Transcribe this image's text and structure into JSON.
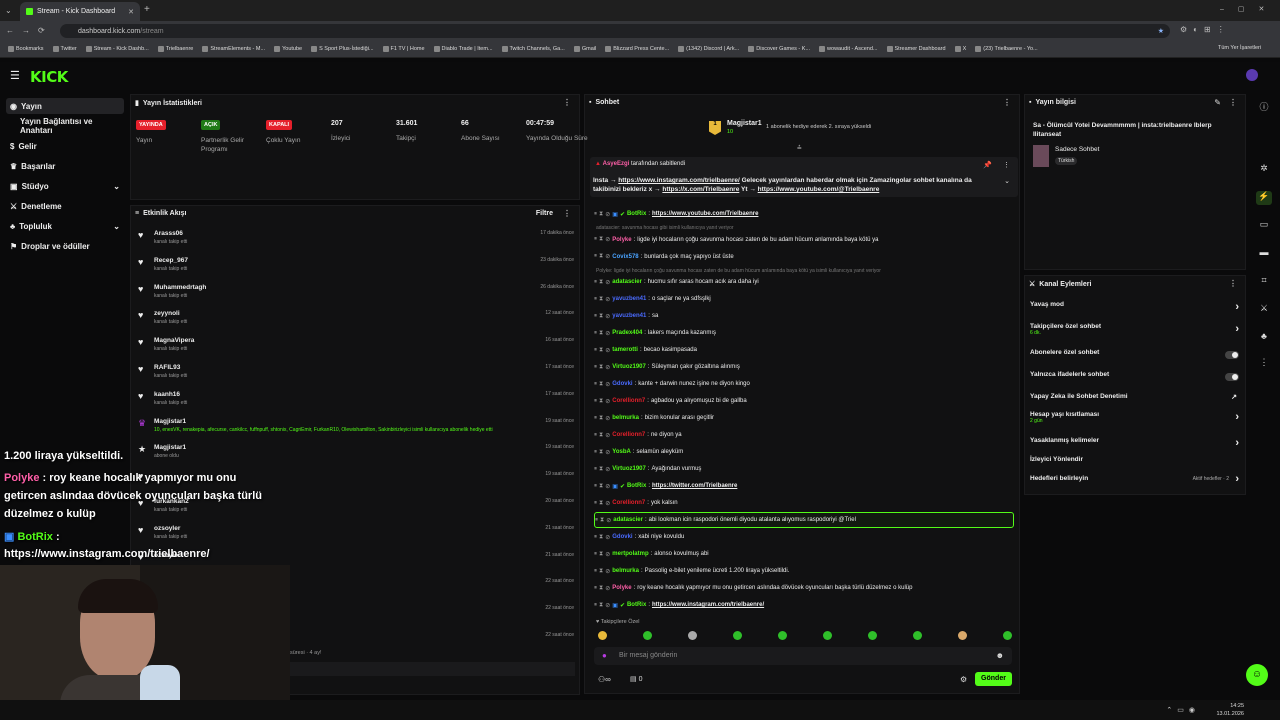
{
  "browser": {
    "tab_title": "Stream - Kick Dashboard",
    "url_domain": "dashboard.kick.com",
    "url_path": "/stream",
    "bookmarks": [
      "Bookmarks",
      "Twitter",
      "Stream - Kick Dashb...",
      "Trielbaenre",
      "StreamElements - M...",
      "Youtube",
      "S Sport Plus-İstediği...",
      "F1 TV | Home",
      "Diablo Trade | Item...",
      "Twitch Channels, Ga...",
      "Gmail",
      "Blizzard Press Cente...",
      "(1342) Discord | Ark...",
      "Discover Games - K...",
      "wowaudit - Ascend...",
      "Streamer Dashboard",
      "X",
      "(23) Trielbaenre - Yo..."
    ],
    "all_bookmarks": "Tüm Yer İşaretleri"
  },
  "sidebar": {
    "items": [
      {
        "label": "Yayın",
        "icon": "broadcast-icon"
      },
      {
        "label": "Yayın Bağlantısı ve Anahtarı",
        "icon": ""
      },
      {
        "label": "Gelir",
        "icon": "money-icon"
      },
      {
        "label": "Başarılar",
        "icon": "trophy-icon"
      },
      {
        "label": "Stüdyo",
        "icon": "studio-icon"
      },
      {
        "label": "Denetleme",
        "icon": "sword-icon"
      },
      {
        "label": "Topluluk",
        "icon": "community-icon"
      },
      {
        "label": "Droplar ve ödüller",
        "icon": "gift-icon"
      }
    ]
  },
  "stats": {
    "title": "Yayın İstatistikleri",
    "items": [
      {
        "badge": "YAYINDA",
        "label": "Yayın",
        "color": "#e5202b"
      },
      {
        "badge": "AÇIK",
        "label": "Partnerlik Gelir Programı",
        "color": "#2a9d19"
      },
      {
        "badge": "KAPALI",
        "label": "Çoklu Yayın",
        "color": "#e5202b"
      },
      {
        "value": "207",
        "label": "İzleyici"
      },
      {
        "value": "31.601",
        "label": "Takipçi"
      },
      {
        "value": "66",
        "label": "Abone Sayısı"
      },
      {
        "value": "00:47:59",
        "label": "Yayında Olduğu Süre"
      }
    ]
  },
  "activity": {
    "title": "Etkinlik Akışı",
    "filter": "Filtre",
    "items": [
      {
        "name": "Arasss06",
        "sub": "kanalı takip etti",
        "time": "17 dakika önce"
      },
      {
        "name": "Recep_967",
        "sub": "kanalı takip etti",
        "time": "23 dakika önce"
      },
      {
        "name": "Muhammedrtagh",
        "sub": "kanalı takip etti",
        "time": "26 dakika önce"
      },
      {
        "name": "zeyynoli",
        "sub": "kanalı takip etti",
        "time": "12 saat önce"
      },
      {
        "name": "MagnaVipera",
        "sub": "kanalı takip etti",
        "time": "16 saat önce"
      },
      {
        "name": "RAFIL93",
        "sub": "kanalı takip etti",
        "time": "17 saat önce"
      },
      {
        "name": "kaanh16",
        "sub": "kanalı takip etti",
        "time": "17 saat önce"
      },
      {
        "name": "Magjistar1",
        "sub": "10, enesVK, renakepia, afecurse, cankilcc, fuffnpuff, shtonix, CagriEmir, FurkanR10, Olewishamilton, Sakinbirizleyici isimli kullanıcıya abonelik hediye etti",
        "time": "19 saat önce"
      },
      {
        "name": "Magjistar1",
        "sub": "abone oldu",
        "time": "19 saat önce"
      },
      {
        "name": "",
        "sub": "",
        "time": "19 saat önce"
      },
      {
        "name": "furkankan2",
        "sub": "kanalı takip etti",
        "time": "20 saat önce"
      },
      {
        "name": "ozsoyler",
        "sub": "kanalı takip etti",
        "time": "21 saat önce"
      },
      {
        "name": "ozsoyler",
        "sub": "",
        "time": "21 saat önce"
      },
      {
        "name": "",
        "sub": "",
        "time": "22 saat önce"
      },
      {
        "name": "",
        "sub": "",
        "time": "22 saat önce"
      },
      {
        "name": "",
        "sub": "",
        "time": "22 saat önce"
      }
    ],
    "bottom_text": "süresi · 4 ay!"
  },
  "chat": {
    "title": "Sohbet",
    "top_user": "Magjistar1",
    "top_count": "10",
    "top_note": "1 abonelik hediye ederek 2. sıraya yükseldi",
    "pinned_by": "AsyeEzgi",
    "pinned_by_suffix": "tarafından sabitlendi",
    "pinned_text_1": "Insta →",
    "pinned_link_1": "https://www.instagram.com/trielbaenre/",
    "pinned_text_2": "Gelecek yayınlardan haberdar olmak için Zamazingolar sohbet kanalına da takibinizi bekleriz x →",
    "pinned_link_2": "https://x.com/Trielbaenre",
    "pinned_text_3": "Yt →",
    "pinned_link_3": "https://www.youtube.com/@Trielbaenre",
    "messages": [
      {
        "user": "BotRix",
        "color": "#53fc18",
        "text": "",
        "link": "https://www.youtube.com/Trielbaenre"
      },
      {
        "reply": "adatascier: savunma hocası gibi isimli kullanıcıya yanıt veriyor"
      },
      {
        "user": "Polyke",
        "color": "#ff5fa8",
        "text": "ligde iyi hocaların çoğu savunma hocası zaten de bu adam hücum anlamında baya kötü ya"
      },
      {
        "user": "Covix578",
        "color": "#4aa3ff",
        "text": "bunlarda çok maç yapıyo üst üste"
      },
      {
        "reply": "Polyke: ligde iyi hocaların çoğu savunma hocası zaten de bu adam hücum anlamında baya kötü ya isimli kullanıcıya yanıt veriyor"
      },
      {
        "user": "adatascier",
        "color": "#53fc18",
        "text": "hucmu sıfır saras hocam acık ara daha iyi"
      },
      {
        "user": "yavuzben41",
        "color": "#4a6bff",
        "text": "o saçlar ne ya sdfsşlkj"
      },
      {
        "user": "yavuzben41",
        "color": "#4a6bff",
        "text": "sa"
      },
      {
        "user": "Pradex404",
        "color": "#53fc18",
        "text": "lakers maçında kazanmış"
      },
      {
        "user": "tamerotti",
        "color": "#53fc18",
        "text": "becao kasimpasada"
      },
      {
        "user": "Virtuoz1907",
        "color": "#53fc18",
        "text": "Süleyman çakır gözaltına alınmış"
      },
      {
        "user": "Gdovki",
        "color": "#4a6bff",
        "text": "kante + darwin nunez işine ne diyon kingo"
      },
      {
        "user": "Corellionn7",
        "color": "#e5202b",
        "text": "agbadou ya alıyomuşuz bi de gallba"
      },
      {
        "user": "belmurka",
        "color": "#53fc18",
        "text": "bizim konular arası geçitlir"
      },
      {
        "user": "Corellionn7",
        "color": "#e5202b",
        "text": "ne diyon ya"
      },
      {
        "user": "YosbA",
        "color": "#53fc18",
        "text": "selamün aleyküm"
      },
      {
        "user": "Virtuoz1907",
        "color": "#53fc18",
        "text": "Ayağından vurmuş"
      },
      {
        "user": "BotRix",
        "color": "#53fc18",
        "text": "",
        "link": "https://twitter.com/Trielbaenre"
      },
      {
        "user": "Corellionn7",
        "color": "#e5202b",
        "text": "yok kalsın"
      },
      {
        "user": "adatascier",
        "color": "#53fc18",
        "text": "abi lookman icin raspodori önemli diyodu atalanta alıyomus raspodoriyi @Triel",
        "highlight": true
      },
      {
        "user": "Gdovki",
        "color": "#4a6bff",
        "text": "xabi niye kovuldu"
      },
      {
        "user": "mertpolatmp",
        "color": "#53fc18",
        "text": "alonso kovulmuş abi"
      },
      {
        "user": "belmurka",
        "color": "#53fc18",
        "text": "Passolig e-bilet yenileme ücreti 1.200 liraya yükseltildi."
      },
      {
        "user": "Polyke",
        "color": "#ff5fa8",
        "text": "roy keane hocalık yapmıyor mu onu getircen aslındaa dövücek oyuncuları başka türlü düzelmez o kulüp"
      },
      {
        "user": "BotRix",
        "color": "#53fc18",
        "text": "",
        "link": "https://www.instagram.com/trielbaenre/"
      }
    ],
    "follower_only": "Takipçilere Özel",
    "input_placeholder": "Bir mesaj gönderin",
    "bottom_count": "0",
    "send_label": "Gönder"
  },
  "stream_info": {
    "title": "Yayın bilgisi",
    "stream_title": "Sa - Ölümcül Yotei Devammmmm | insta:trielbaenre Iblerp Ilitanseat",
    "category": "Sadece Sohbet",
    "tag": "Türkish"
  },
  "channel_actions": {
    "title": "Kanal Eylemleri",
    "items": [
      {
        "label": "Yavaş mod",
        "sub": "",
        "control": "arrow"
      },
      {
        "label": "Takipçilere özel sohbet",
        "sub": "6 dk.",
        "control": "arrow"
      },
      {
        "label": "Abonelere özel sohbet",
        "sub": "",
        "control": "toggle"
      },
      {
        "label": "Yalnızca ifadelerle sohbet",
        "sub": "",
        "control": "toggle"
      },
      {
        "label": "Yapay Zeka ile Sohbet Denetimi",
        "sub": "",
        "control": "external"
      },
      {
        "label": "Hesap yaşı kısıtlaması",
        "sub": "2 gün",
        "control": "arrow"
      },
      {
        "label": "Yasaklanmış kelimeler",
        "sub": "",
        "control": "arrow"
      },
      {
        "label": "İzleyici Yönlendir",
        "sub": "",
        "control": ""
      },
      {
        "label": "Hedefleri belirleyin",
        "sub": "",
        "control": "goals",
        "extra": "Aktif hedefler · 2"
      }
    ]
  },
  "overlay": {
    "line1": "1.200 liraya yükseltildi.",
    "user1": "Polyke",
    "line2": ": roy keane hocalık yapmıyor mu onu",
    "line3": "getircen aslındaa dövücek oyuncuları başka türlü",
    "line4": "düzelmez o kulüp",
    "user2": "BotRix",
    "line5": ":",
    "line6": "https://www.instagram.com/trielbaenre/"
  },
  "taskbar": {
    "time": "14:25",
    "date": "13.01.2026"
  }
}
